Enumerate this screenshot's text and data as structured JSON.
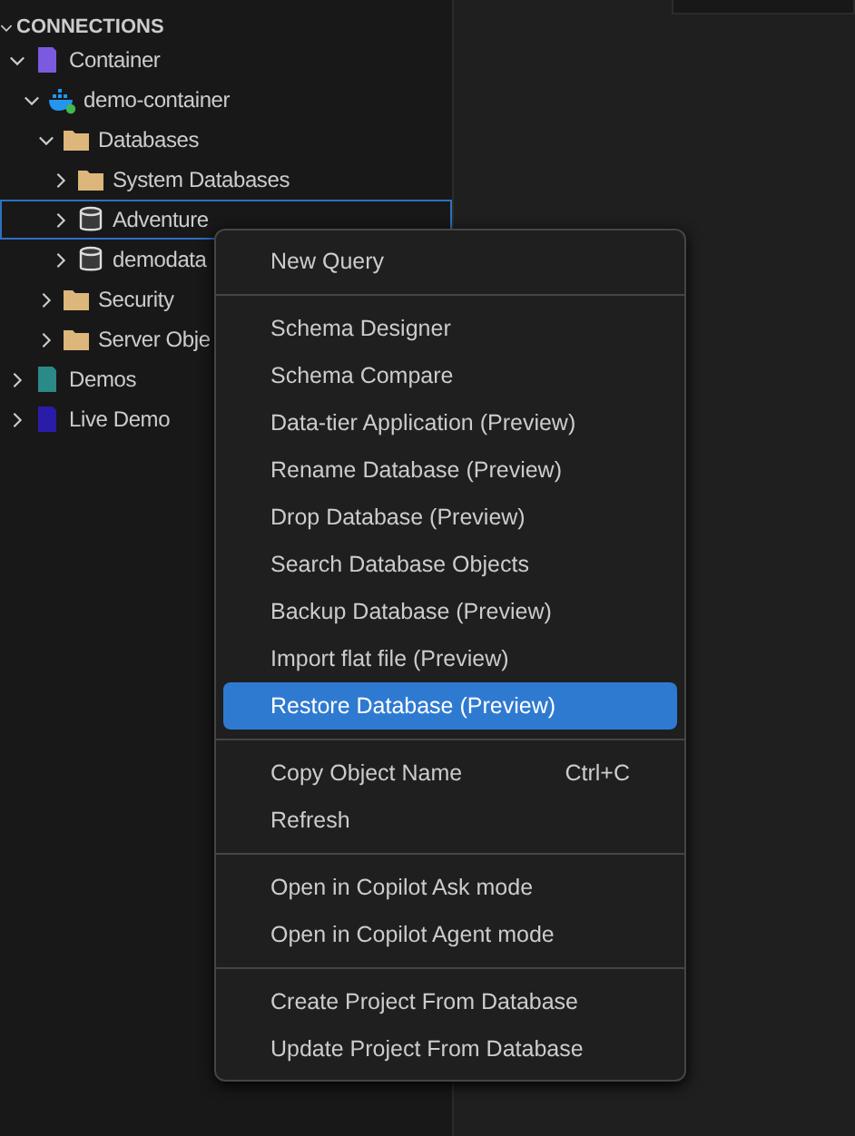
{
  "sidebar": {
    "title": "CONNECTIONS",
    "expanded": true,
    "tree": [
      {
        "label": "Container",
        "kind": "group",
        "color": "#7b5ae0",
        "expanded": true,
        "selected": false,
        "children": [
          {
            "label": "demo-container",
            "kind": "docker",
            "expanded": true,
            "selected": false,
            "children": [
              {
                "label": "Databases",
                "kind": "folder",
                "expanded": true,
                "selected": false,
                "children": [
                  {
                    "label": "System Databases",
                    "kind": "folder",
                    "expanded": false,
                    "selected": false
                  },
                  {
                    "label": "Adventure",
                    "kind": "database",
                    "expanded": false,
                    "selected": true
                  },
                  {
                    "label": "demodata",
                    "kind": "database",
                    "expanded": false,
                    "selected": false
                  }
                ]
              },
              {
                "label": "Security",
                "kind": "folder",
                "expanded": false,
                "selected": false
              },
              {
                "label": "Server Obje",
                "kind": "folder",
                "expanded": false,
                "selected": false
              }
            ]
          }
        ]
      },
      {
        "label": "Demos",
        "kind": "group",
        "color": "#2b8a87",
        "expanded": false,
        "selected": false
      },
      {
        "label": "Live Demo",
        "kind": "group",
        "color": "#2a1ca8",
        "expanded": false,
        "selected": false
      }
    ]
  },
  "context_menu": {
    "groups": [
      [
        {
          "label": "New Query",
          "selected": false
        }
      ],
      [
        {
          "label": "Schema Designer",
          "selected": false
        },
        {
          "label": "Schema Compare",
          "selected": false
        },
        {
          "label": "Data-tier Application (Preview)",
          "selected": false
        },
        {
          "label": "Rename Database (Preview)",
          "selected": false
        },
        {
          "label": "Drop Database (Preview)",
          "selected": false
        },
        {
          "label": "Search Database Objects",
          "selected": false
        },
        {
          "label": "Backup Database (Preview)",
          "selected": false
        },
        {
          "label": "Import flat file (Preview)",
          "selected": false
        },
        {
          "label": "Restore Database (Preview)",
          "selected": true
        }
      ],
      [
        {
          "label": "Copy Object Name",
          "shortcut": "Ctrl+C",
          "selected": false
        },
        {
          "label": "Refresh",
          "selected": false
        }
      ],
      [
        {
          "label": "Open in Copilot Ask mode",
          "selected": false
        },
        {
          "label": "Open in Copilot Agent mode",
          "selected": false
        }
      ],
      [
        {
          "label": "Create Project From Database",
          "selected": false
        },
        {
          "label": "Update Project From Database",
          "selected": false
        }
      ]
    ]
  }
}
